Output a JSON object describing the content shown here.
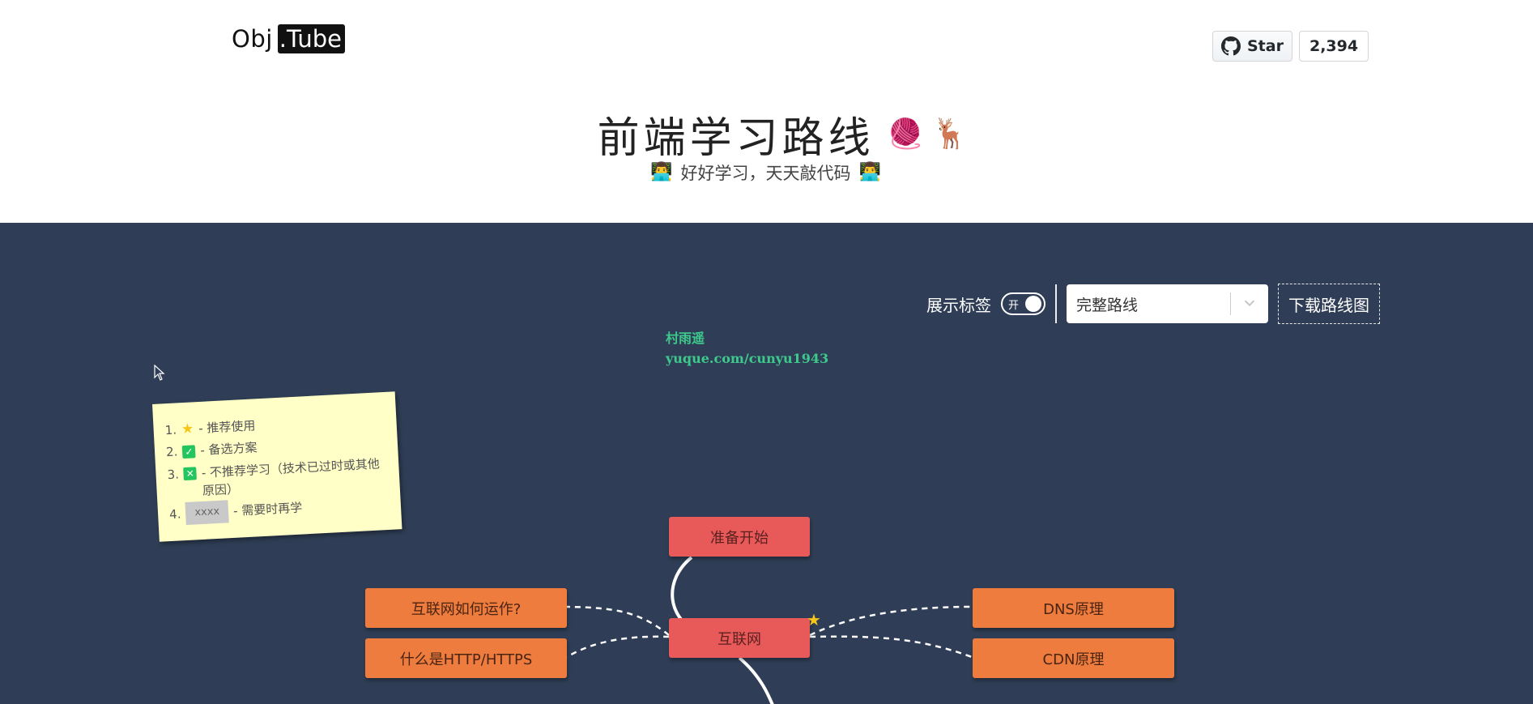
{
  "header": {
    "logo_left": "Obj",
    "logo_right": ".Tube",
    "github": {
      "star_label": "Star",
      "count": "2,394"
    },
    "title": "前端学习路线",
    "title_emojis": [
      "🧶",
      "🦌"
    ],
    "subtitle": "好好学习，天天敲代码",
    "subtitle_emoji": "👨‍💻"
  },
  "controls": {
    "show_labels_label": "展示标签",
    "toggle_text": "开",
    "toggle_on": true,
    "route_select_value": "完整路线",
    "download_label": "下载路线图"
  },
  "watermark": {
    "line1": "村雨遥",
    "line2": "yuque.com/cunyu1943"
  },
  "legend": {
    "items": [
      {
        "num": "1.",
        "icon": "star-icon",
        "text": "- 推荐使用"
      },
      {
        "num": "2.",
        "icon": "check-icon",
        "text": "- 备选方案"
      },
      {
        "num": "3.",
        "icon": "x-icon",
        "text": "- 不推荐学习（技术已过时或其他原因）"
      },
      {
        "num": "4.",
        "tag": "xxxx",
        "text": "- 需要时再学"
      }
    ]
  },
  "nodes": {
    "start": "准备开始",
    "internet": "互联网",
    "how_internet_works": "互联网如何运作?",
    "http_https": "什么是HTTP/HTTPS",
    "dns": "DNS原理",
    "cdn": "CDN原理"
  },
  "colors": {
    "roadmap_bg": "#2f3e56",
    "primary_node": "#e85a59",
    "secondary_node": "#ee7c3e",
    "legend_bg": "#ffffc7",
    "watermark": "#3ec98c",
    "star": "#f5c518"
  }
}
